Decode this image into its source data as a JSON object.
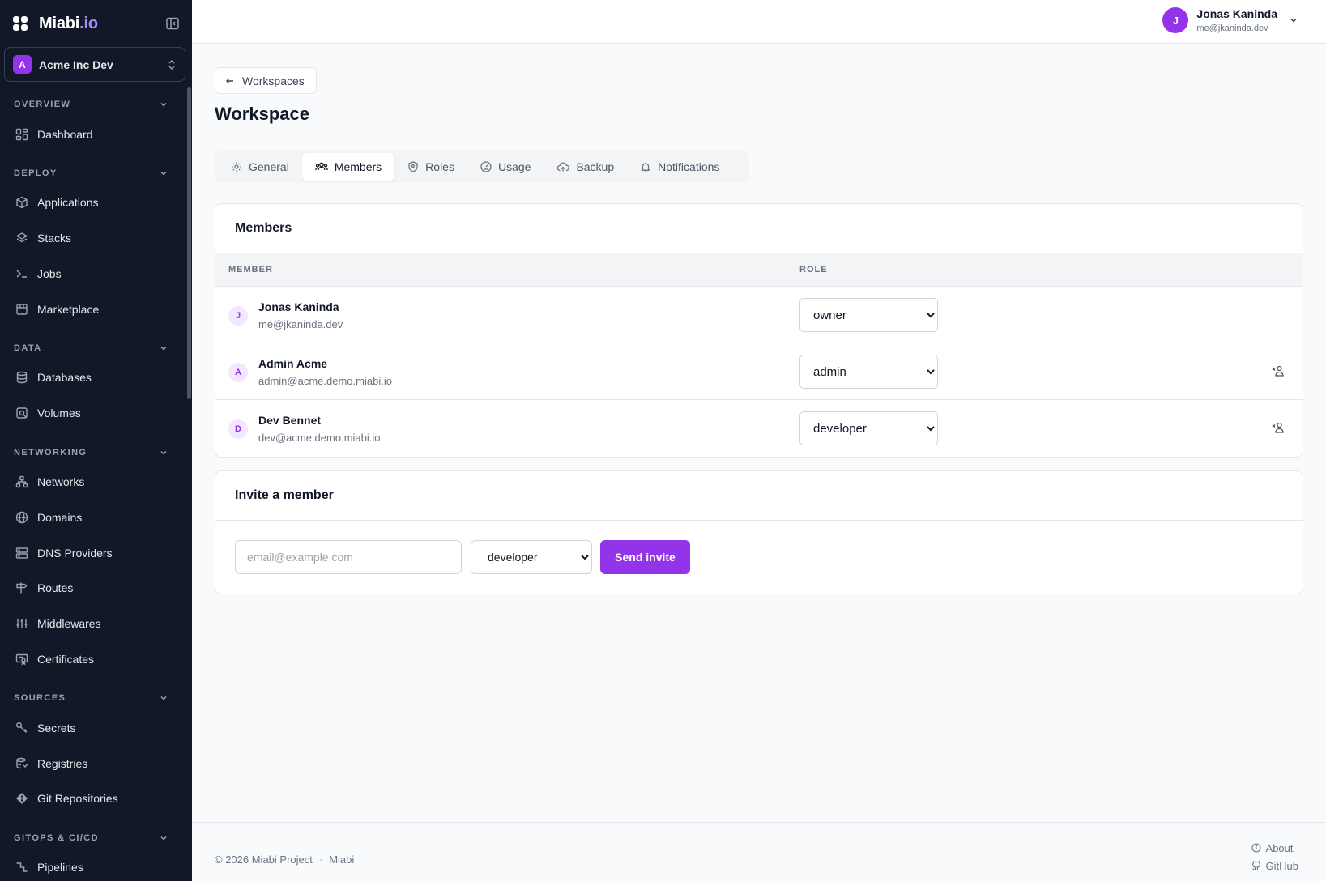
{
  "brand": {
    "name": "Miabi",
    "tld": ".io"
  },
  "workspace_switcher": {
    "initial": "A",
    "name": "Acme Inc Dev"
  },
  "sidebar": {
    "sections": [
      {
        "label": "OVERVIEW",
        "items": [
          {
            "label": "Dashboard",
            "icon": "dashboard-icon"
          }
        ]
      },
      {
        "label": "DEPLOY",
        "items": [
          {
            "label": "Applications",
            "icon": "box-icon"
          },
          {
            "label": "Stacks",
            "icon": "layers-icon"
          },
          {
            "label": "Jobs",
            "icon": "terminal-icon"
          },
          {
            "label": "Marketplace",
            "icon": "store-icon"
          }
        ]
      },
      {
        "label": "DATA",
        "items": [
          {
            "label": "Databases",
            "icon": "database-icon"
          },
          {
            "label": "Volumes",
            "icon": "volume-icon"
          }
        ]
      },
      {
        "label": "NETWORKING",
        "items": [
          {
            "label": "Networks",
            "icon": "network-icon"
          },
          {
            "label": "Domains",
            "icon": "globe-icon"
          },
          {
            "label": "DNS Providers",
            "icon": "server-icon"
          },
          {
            "label": "Routes",
            "icon": "signpost-icon"
          },
          {
            "label": "Middlewares",
            "icon": "sliders-icon"
          },
          {
            "label": "Certificates",
            "icon": "certificate-icon"
          }
        ]
      },
      {
        "label": "SOURCES",
        "items": [
          {
            "label": "Secrets",
            "icon": "key-icon"
          },
          {
            "label": "Registries",
            "icon": "registry-icon"
          },
          {
            "label": "Git Repositories",
            "icon": "git-icon"
          }
        ]
      },
      {
        "label": "GITOPS & CI/CD",
        "items": [
          {
            "label": "Pipelines",
            "icon": "pipeline-icon"
          }
        ]
      }
    ]
  },
  "topbar": {
    "user": {
      "initial": "J",
      "name": "Jonas Kaninda",
      "email": "me@jkaninda.dev"
    }
  },
  "main": {
    "back_label": "Workspaces",
    "title": "Workspace",
    "tabs": [
      {
        "label": "General",
        "icon": "gear-icon",
        "active": false
      },
      {
        "label": "Members",
        "icon": "users-icon",
        "active": true
      },
      {
        "label": "Roles",
        "icon": "shield-icon",
        "active": false
      },
      {
        "label": "Usage",
        "icon": "gauge-icon",
        "active": false
      },
      {
        "label": "Backup",
        "icon": "cloud-icon",
        "active": false
      },
      {
        "label": "Notifications",
        "icon": "bell-icon",
        "active": false
      }
    ],
    "members_card": {
      "title": "Members",
      "columns": [
        "MEMBER",
        "ROLE"
      ],
      "rows": [
        {
          "initial": "J",
          "name": "Jonas Kaninda",
          "email": "me@jkaninda.dev",
          "role": "owner",
          "removable": false
        },
        {
          "initial": "A",
          "name": "Admin Acme",
          "email": "admin@acme.demo.miabi.io",
          "role": "admin",
          "removable": true
        },
        {
          "initial": "D",
          "name": "Dev Bennet",
          "email": "dev@acme.demo.miabi.io",
          "role": "developer",
          "removable": true
        }
      ]
    },
    "invite_card": {
      "title": "Invite a member",
      "email_placeholder": "email@example.com",
      "role_value": "developer",
      "send_label": "Send invite"
    }
  },
  "footer": {
    "copyright": "© 2026 Miabi Project",
    "separator": "·",
    "project": "Miabi",
    "links": [
      {
        "label": "About",
        "icon": "info-icon"
      },
      {
        "label": "GitHub",
        "icon": "github-icon"
      }
    ]
  },
  "colors": {
    "accent": "#9333ea",
    "sidebar_bg": "#111827",
    "page_bg": "#f9fafb"
  }
}
